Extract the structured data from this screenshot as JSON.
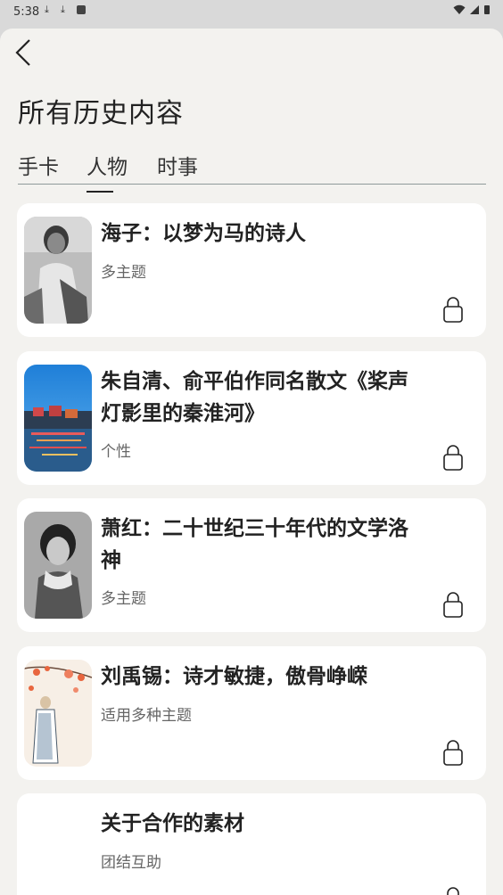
{
  "status": {
    "time": "5:38"
  },
  "page": {
    "title": "所有历史内容"
  },
  "tabs": [
    {
      "label": "手卡"
    },
    {
      "label": "人物"
    },
    {
      "label": "时事"
    }
  ],
  "cards": [
    {
      "title": "海子：以梦为马的诗人",
      "subtitle": "多主题",
      "locked": true
    },
    {
      "title": "朱自清、俞平伯作同名散文《桨声灯影里的秦淮河》",
      "subtitle": "个性",
      "locked": true
    },
    {
      "title": "萧红：二十世纪三十年代的文学洛神",
      "subtitle": "多主题",
      "locked": true
    },
    {
      "title": "刘禹锡：诗才敏捷，傲骨峥嵘",
      "subtitle": "适用多种主题",
      "locked": true
    },
    {
      "title": "关于合作的素材",
      "subtitle": "团结互助",
      "locked": true
    }
  ],
  "active_tab": "人物"
}
